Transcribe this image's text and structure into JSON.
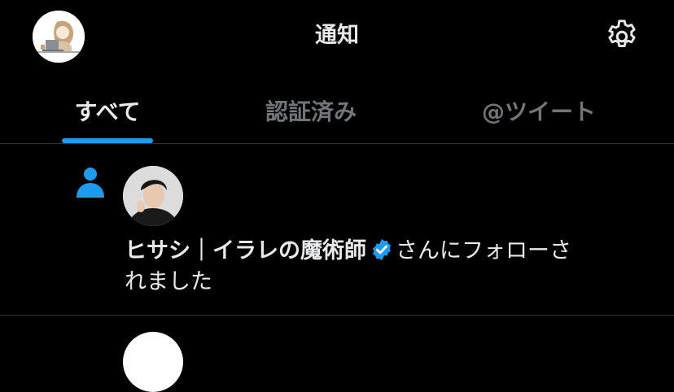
{
  "header": {
    "title": "通知"
  },
  "tabs": [
    {
      "label": "すべて",
      "active": true
    },
    {
      "label": "認証済み",
      "active": false
    },
    {
      "label": "@ツイート",
      "active": false
    }
  ],
  "icons": {
    "settings": "gear-icon",
    "follow": "person-icon",
    "verified": "verified-badge-icon"
  },
  "colors": {
    "background": "#000000",
    "accent": "#1d9bf0",
    "text": "#e7e9ea",
    "muted": "#71767b"
  },
  "notifications": [
    {
      "type": "follow",
      "user_name": "ヒサシ｜イラレの魔術師",
      "verified": true,
      "message_line1": "さんにフォローさ",
      "message_line2": "れました"
    }
  ]
}
